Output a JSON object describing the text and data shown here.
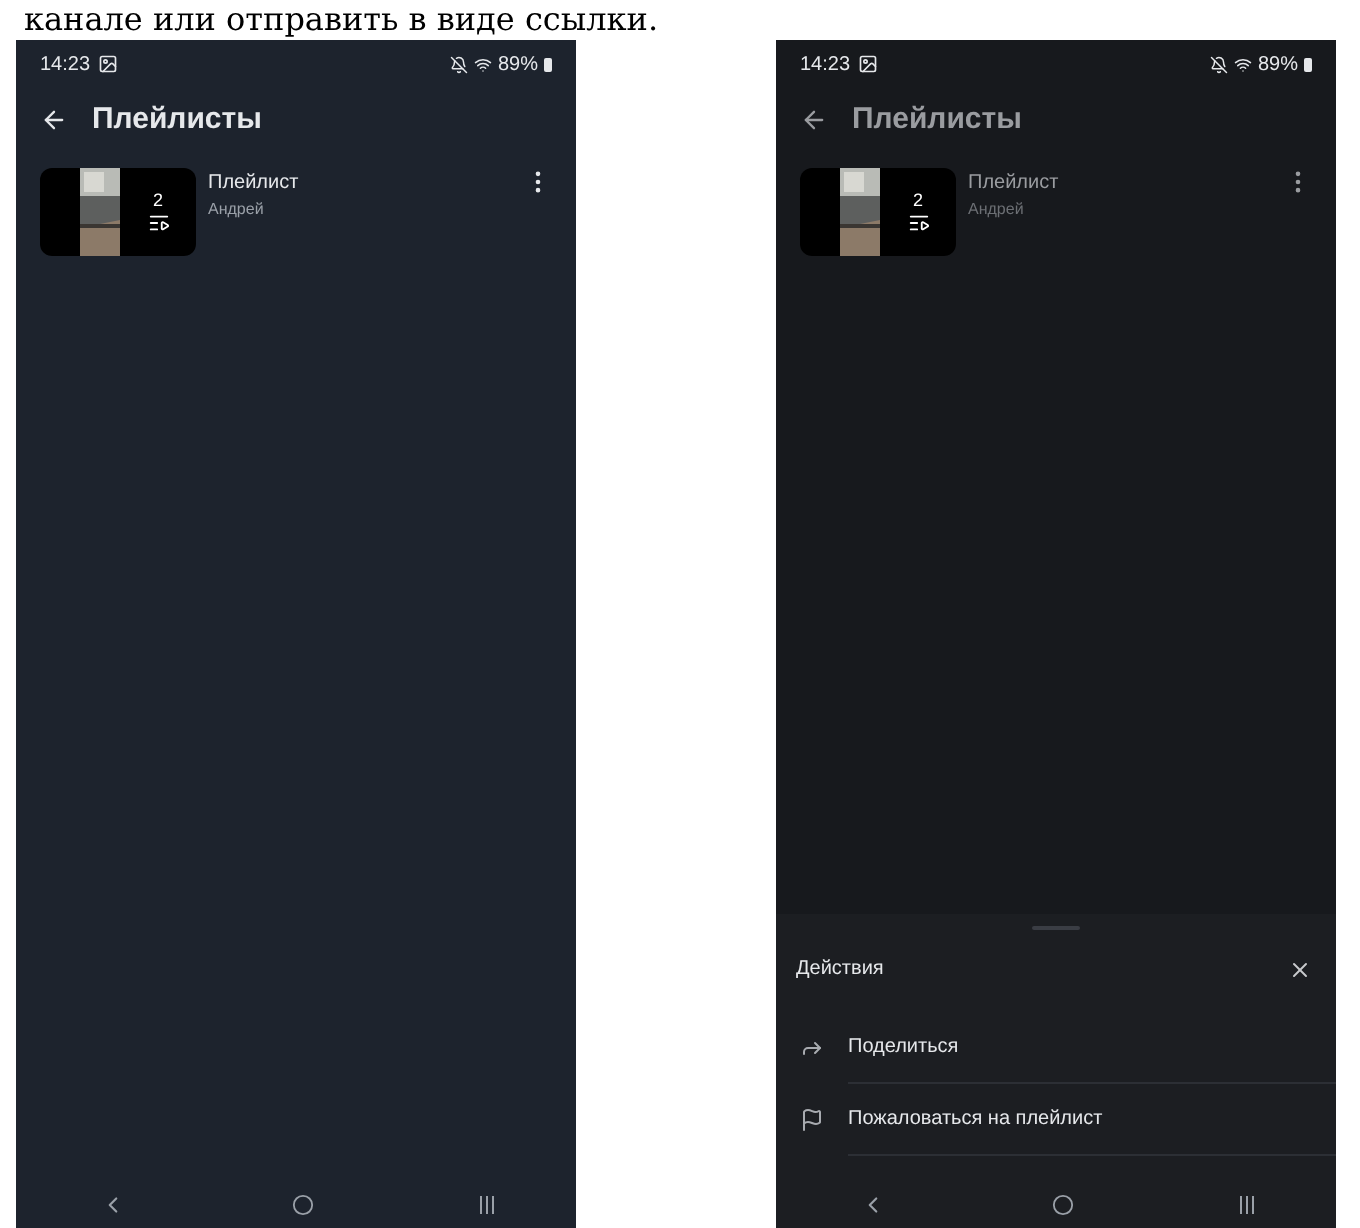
{
  "caption": "канале или отправить в виде ссылки.",
  "screens": [
    {
      "status_bar": {
        "time": "14:23",
        "battery": "89%"
      },
      "title": "Плейлисты",
      "dimmed": false,
      "playlists": [
        {
          "name": "Плейлист",
          "author": "Андрей",
          "count": "2"
        }
      ]
    },
    {
      "status_bar": {
        "time": "14:23",
        "battery": "89%"
      },
      "title": "Плейлисты",
      "dimmed": true,
      "playlists": [
        {
          "name": "Плейлист",
          "author": "Андрей",
          "count": "2"
        }
      ],
      "action_sheet": {
        "title": "Действия",
        "actions": [
          {
            "kind": "share",
            "label": "Поделиться"
          },
          {
            "kind": "report",
            "label": "Пожаловаться на плейлист"
          }
        ]
      }
    }
  ]
}
